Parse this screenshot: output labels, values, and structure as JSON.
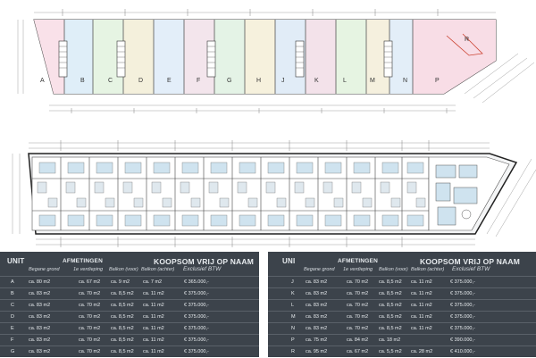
{
  "plan": {
    "upper_units": [
      "A",
      "B",
      "C",
      "D",
      "E",
      "F",
      "G",
      "H",
      "J",
      "K",
      "L",
      "M",
      "N",
      "P"
    ],
    "upper_extra": "R"
  },
  "tables": {
    "left": {
      "unit": "UNIT",
      "afmetingen": "AFMETINGEN",
      "koopsom": "KOOPSOM VRIJ OP NAAM",
      "sub_begane": "Begane grond",
      "sub_verdieping": "1e verdieping",
      "sub_balkon_voor": "Balkon (voor)",
      "sub_balkon_achter": "Balkon (achter)",
      "exclusief": "Exclusief BTW",
      "rows": [
        {
          "unit": "A",
          "bg": "ca. 80 m2",
          "v1": "ca. 67 m2",
          "bv": "ca. 9   m2",
          "ba": "ca. 7 m2",
          "price": "€ 365.000,-"
        },
        {
          "unit": "B",
          "bg": "ca. 83 m2",
          "v1": "ca. 70 m2",
          "bv": "ca. 8,5 m2",
          "ba": "ca. 11 m2",
          "price": "€ 375.000,-"
        },
        {
          "unit": "C",
          "bg": "ca. 83 m2",
          "v1": "ca. 70 m2",
          "bv": "ca. 8,5 m2",
          "ba": "ca. 11 m2",
          "price": "€ 375.000,-"
        },
        {
          "unit": "D",
          "bg": "ca. 83 m2",
          "v1": "ca. 70 m2",
          "bv": "ca. 8,5 m2",
          "ba": "ca. 11 m2",
          "price": "€ 375.000,-"
        },
        {
          "unit": "E",
          "bg": "ca. 83 m2",
          "v1": "ca. 70 m2",
          "bv": "ca. 8,5 m2",
          "ba": "ca. 11 m2",
          "price": "€ 375.000,-"
        },
        {
          "unit": "F",
          "bg": "ca. 83 m2",
          "v1": "ca. 70 m2",
          "bv": "ca. 8,5 m2",
          "ba": "ca. 11 m2",
          "price": "€ 375.000,-"
        },
        {
          "unit": "G",
          "bg": "ca. 83 m2",
          "v1": "ca. 70 m2",
          "bv": "ca. 8,5 m2",
          "ba": "ca. 11 m2",
          "price": "€ 375.000,-"
        }
      ]
    },
    "right": {
      "unit": "UNI",
      "afmetingen": "AFMETINGEN",
      "koopsom": "KOOPSOM VRIJ OP NAAM",
      "sub_begane": "Begane grond",
      "sub_verdieping": "1e verdieping",
      "sub_balkon_voor": "Balkon (voor)",
      "sub_balkon_achter": "Balkon (achter)",
      "exclusief": "Exclusief BTW",
      "rows": [
        {
          "unit": "J",
          "bg": "ca. 83 m2",
          "v1": "ca. 70 m2",
          "bv": "ca. 8,5 m2",
          "ba": "ca. 11 m2",
          "price": "€ 375.000,-"
        },
        {
          "unit": "K",
          "bg": "ca. 83 m2",
          "v1": "ca. 70 m2",
          "bv": "ca. 8,5 m2",
          "ba": "ca. 11 m2",
          "price": "€ 375.000,-"
        },
        {
          "unit": "L",
          "bg": "ca. 83 m2",
          "v1": "ca. 70 m2",
          "bv": "ca. 8,5 m2",
          "ba": "ca. 11 m2",
          "price": "€ 375.000,-"
        },
        {
          "unit": "M",
          "bg": "ca. 83 m2",
          "v1": "ca. 70 m2",
          "bv": "ca. 8,5 m2",
          "ba": "ca. 11 m2",
          "price": "€ 375.000,-"
        },
        {
          "unit": "N",
          "bg": "ca. 83 m2",
          "v1": "ca. 70 m2",
          "bv": "ca. 8,5 m2",
          "ba": "ca. 11 m2",
          "price": "€ 375.000,-"
        },
        {
          "unit": "P",
          "bg": "ca. 75 m2",
          "v1": "ca. 84 m2",
          "bv": "ca. 18  m2",
          "ba": "",
          "price": "€ 390.000,-"
        },
        {
          "unit": "R",
          "bg": "ca. 95 m2",
          "v1": "ca. 67 m2",
          "bv": "ca. 5,5 m2",
          "ba": "ca. 28 m2",
          "price": "€ 410.000,-"
        }
      ]
    }
  }
}
